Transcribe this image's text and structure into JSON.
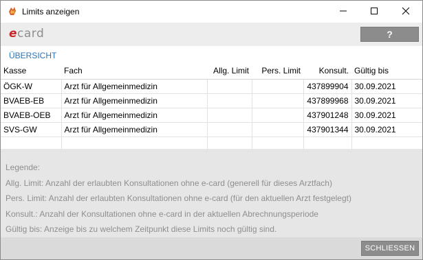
{
  "window": {
    "title": "Limits anzeigen"
  },
  "brand": {
    "logo_e": "e",
    "logo_rest": "card"
  },
  "help_button": {
    "label": "?"
  },
  "section": {
    "title": "ÜBERSICHT"
  },
  "table": {
    "headers": [
      "Kasse",
      "Fach",
      "Allg. Limit",
      "Pers. Limit",
      "Konsult.",
      "Gültig bis"
    ],
    "rows": [
      [
        "ÖGK-W",
        "Arzt für Allgemeinmedizin",
        "",
        "",
        "437899904",
        "30.09.2021"
      ],
      [
        "BVAEB-EB",
        "Arzt für Allgemeinmedizin",
        "",
        "",
        "437899968",
        "30.09.2021"
      ],
      [
        "BVAEB-OEB",
        "Arzt für Allgemeinmedizin",
        "",
        "",
        "437901248",
        "30.09.2021"
      ],
      [
        "SVS-GW",
        "Arzt für Allgemeinmedizin",
        "",
        "",
        "437901344",
        "30.09.2021"
      ],
      [
        "",
        "",
        "",
        "",
        "",
        ""
      ]
    ]
  },
  "legend": [
    "Legende:",
    "Allg. Limit: Anzahl der erlaubten Konsultationen ohne e-card (generell für dieses Arztfach)",
    "Pers. Limit: Anzahl der erlaubten Konsultationen ohne e-card (für den aktuellen Arzt festgelegt)",
    "Konsult.: Anzahl der Konsultationen ohne e-card in der aktuellen Abrechnungsperiode",
    "Gültig bis: Anzeige bis zu welchem Zeitpunkt diese Limits noch gültig sind."
  ],
  "footer": {
    "close_label": "SCHLIESSEN"
  },
  "colors": {
    "accent": "#2a73b8",
    "brand_red": "#c8262b",
    "button_gray": "#8c8c8c"
  },
  "icons": [
    "app-icon",
    "minimize-icon",
    "maximize-icon",
    "close-icon"
  ]
}
